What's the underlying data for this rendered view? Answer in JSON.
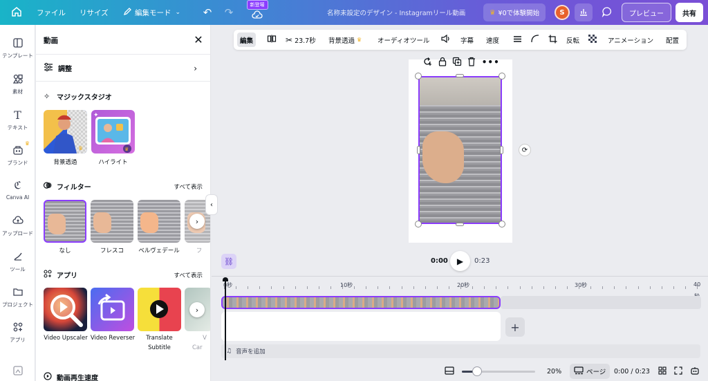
{
  "topbar": {
    "file": "ファイル",
    "resize": "リサイズ",
    "edit_mode": "編集モード",
    "new_badge": "新登場",
    "title": "名称未設定のデザイン - Instagramリール動画",
    "trial": "¥0で体験開始",
    "avatar_initial": "S",
    "preview": "プレビュー",
    "share": "共有"
  },
  "rail": {
    "items": [
      {
        "label": "テンプレート",
        "icon": "template-icon"
      },
      {
        "label": "素材",
        "icon": "elements-icon"
      },
      {
        "label": "テキスト",
        "icon": "text-icon"
      },
      {
        "label": "ブランド",
        "icon": "brand-icon"
      },
      {
        "label": "Canva AI",
        "icon": "canva-ai-icon"
      },
      {
        "label": "アップロード",
        "icon": "upload-icon"
      },
      {
        "label": "ツール",
        "icon": "tools-icon"
      },
      {
        "label": "プロジェクト",
        "icon": "folder-icon"
      },
      {
        "label": "アプリ",
        "icon": "apps-icon"
      }
    ]
  },
  "panel": {
    "title": "動画",
    "adjust": "調整",
    "magic_studio": {
      "heading": "マジックスタジオ",
      "items": [
        "背景透過",
        "ハイライト"
      ]
    },
    "filters": {
      "heading": "フィルター",
      "see_all": "すべて表示",
      "items": [
        "なし",
        "フレスコ",
        "ベルヴェデール",
        "フ"
      ]
    },
    "apps": {
      "heading": "アプリ",
      "see_all": "すべて表示",
      "items": [
        {
          "line1": "Video Upscaler",
          "line2": ""
        },
        {
          "line1": "Video Reverser",
          "line2": ""
        },
        {
          "line1": "Translate",
          "line2": "Subtitle"
        },
        {
          "line1": "V",
          "line2": "Car"
        }
      ]
    },
    "speed_heading": "動画再生速度"
  },
  "toolbar": {
    "edit": "編集",
    "duration": "23.7秒",
    "bg_remove": "背景透過",
    "audio_tool": "オーディオツール",
    "captions": "字幕",
    "speed": "速度",
    "flip": "反転",
    "animation": "アニメーション",
    "position": "配置"
  },
  "playback": {
    "current": "0:00",
    "total": "0:23"
  },
  "timeline": {
    "ticks": [
      "0秒",
      "10秒",
      "20秒",
      "30秒",
      "40"
    ],
    "tick_suffix": "秒",
    "add_audio": "音声を追加"
  },
  "bottombar": {
    "zoom": "20%",
    "page": "ページ",
    "time": "0:00 / 0:23"
  },
  "colors": {
    "accent": "#8b3dff",
    "crown": "#f0b429"
  }
}
